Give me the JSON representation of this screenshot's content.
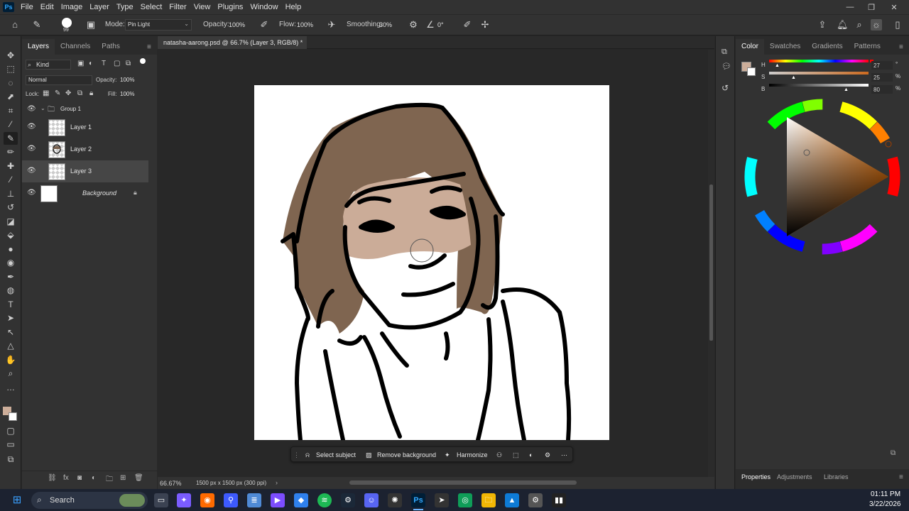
{
  "app": {
    "logo": "Ps",
    "menus": [
      "File",
      "Edit",
      "Image",
      "Layer",
      "Type",
      "Select",
      "Filter",
      "View",
      "Plugins",
      "Window",
      "Help"
    ]
  },
  "options": {
    "brush_size": "99",
    "mode_label": "Mode:",
    "mode_value": "Pin Light",
    "opacity_label": "Opacity:",
    "opacity_value": "100%",
    "flow_label": "Flow:",
    "flow_value": "100%",
    "smoothing_label": "Smoothing:",
    "smoothing_value": "30%",
    "angle_value": "0°"
  },
  "layers_panel": {
    "tabs": [
      "Layers",
      "Channels",
      "Paths"
    ],
    "filter_label": "Kind",
    "blend_mode": "Normal",
    "opacity_label": "Opacity:",
    "opacity_value": "100%",
    "lock_label": "Lock:",
    "fill_label": "Fill:",
    "fill_value": "100%",
    "layers": [
      {
        "name": "Group 1"
      },
      {
        "name": "Layer 1"
      },
      {
        "name": "Layer 2"
      },
      {
        "name": "Layer 3"
      },
      {
        "name": "Background"
      }
    ]
  },
  "document": {
    "tab_title": "natasha-aarong.psd @ 66.7% (Layer 3, RGB/8) *",
    "zoom": "66.67%",
    "doc_info": "1500 px x 1500 px (300 ppi)"
  },
  "context_bar": {
    "select_subject": "Select subject",
    "remove_background": "Remove background",
    "harmonize": "Harmonize"
  },
  "color_panel": {
    "tabs": [
      "Color",
      "Swatches",
      "Gradients",
      "Patterns"
    ],
    "h_label": "H",
    "s_label": "S",
    "b_label": "B",
    "h_value": "27",
    "s_value": "25",
    "b_value": "80",
    "h_unit": "°",
    "s_unit": "%",
    "b_unit": "%",
    "foreground_color": "#ccad99",
    "background_color": "#ffffff"
  },
  "bottom_tabs": [
    "Properties",
    "Adjustments",
    "Libraries"
  ],
  "taskbar": {
    "search_label": "Search",
    "time": "01:11 PM",
    "date": "3/22/2026"
  }
}
